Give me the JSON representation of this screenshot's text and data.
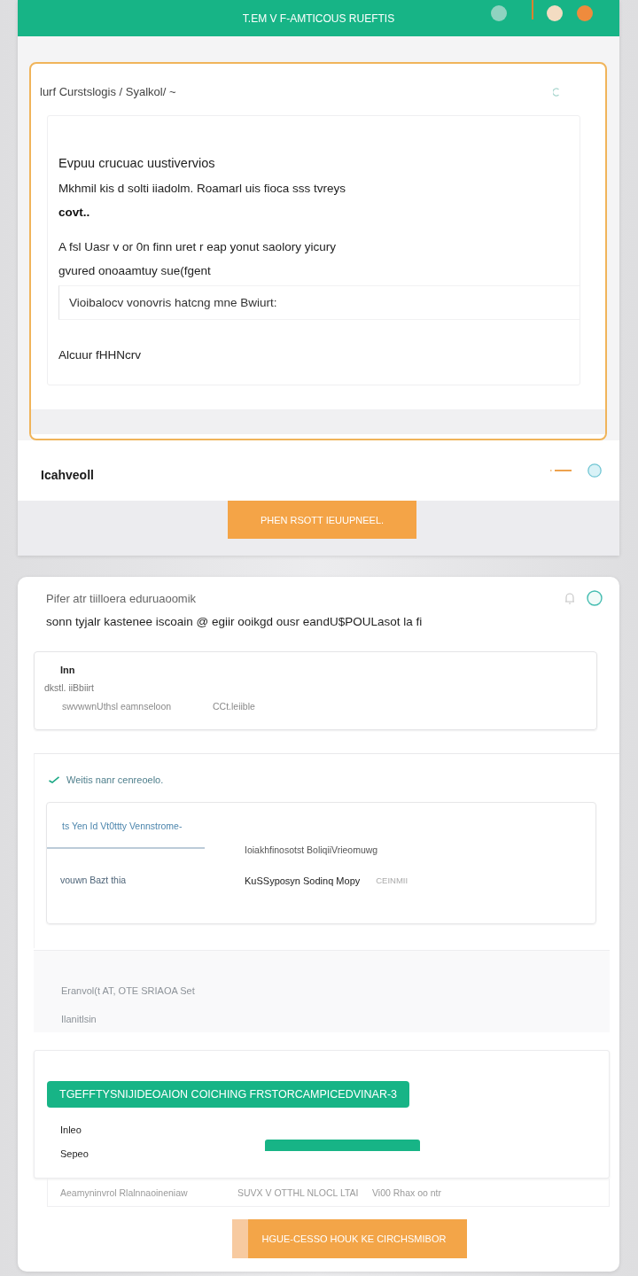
{
  "header": {
    "title": "T.EM V F-AMTICOUS RUEFTIS",
    "dots": [
      {
        "color": "#8fd3c0"
      },
      {
        "color": "#f3dcc2"
      },
      {
        "color": "#ef8b3d"
      }
    ]
  },
  "overview": {
    "breadcrumb": "lurf Curstslogis / Syalkol/ ~",
    "heading": "Evpuu crucuac uustivervios",
    "intro": "Mkhmil kis d solti iiadolm. Roamarl uis fioca sss tvreys",
    "emphasis": "covt..",
    "paragraph": [
      "A fsl Uasr v or 0n finn uret r eap yonut saolory yicury",
      "gvured onoaamtuy sue(fgent"
    ],
    "quote": "Vioibalocv vonovris hatcng mne Bwiurt:",
    "footnote": "Alcuur fHHNcrv"
  },
  "section": {
    "title": "Icahveoll",
    "button": "PHEN RSOTT IEUUPNEEL."
  },
  "details": {
    "title": "Pifer atr tiilloera eduruaoomik",
    "subtitle": "sonn tyjalr kastenee iscoain @ egiir ooikgd ousr eandU$POULasot la fi",
    "record": {
      "name": "Inn",
      "meta": "dkstl. iiBbiirt",
      "fields": [
        "swvwwnUthsl eamnseloon",
        "CCt.leiible"
      ]
    },
    "status": "Weitis nanr cenreoelo.",
    "tabs": [
      {
        "label": "ts Yen Id Vt0ttty Vennstrome-",
        "selected": true
      }
    ],
    "table": {
      "heading": "Ioiakhfinosotst BoliqiiVrieomuwg",
      "row_label": "vouwn Bazt thia",
      "cells": [
        {
          "text": "KuSSyposyn Sodinq Mopy",
          "muted": false
        },
        {
          "text": "CEINMII",
          "muted": true
        }
      ]
    },
    "notes": [
      "Eranvol(t AT, OTE SRIAOA Set",
      "Ilanitlsin"
    ]
  },
  "progress": {
    "banner": "TGEFFTYSNIJIDEOAION COICHING FRSTORCAMPICEDVINAR-3",
    "rows": [
      "Inleo",
      "Sepeo"
    ],
    "footer": [
      "Aeamyninvrol Rlalnnaoineniaw",
      "SUVX V OTTHL NLOCL LTAI",
      "Vi00 Rhax oo ntr"
    ],
    "button": "HGUE-CESSO HOUK KE CIRCHSMIBOR"
  }
}
